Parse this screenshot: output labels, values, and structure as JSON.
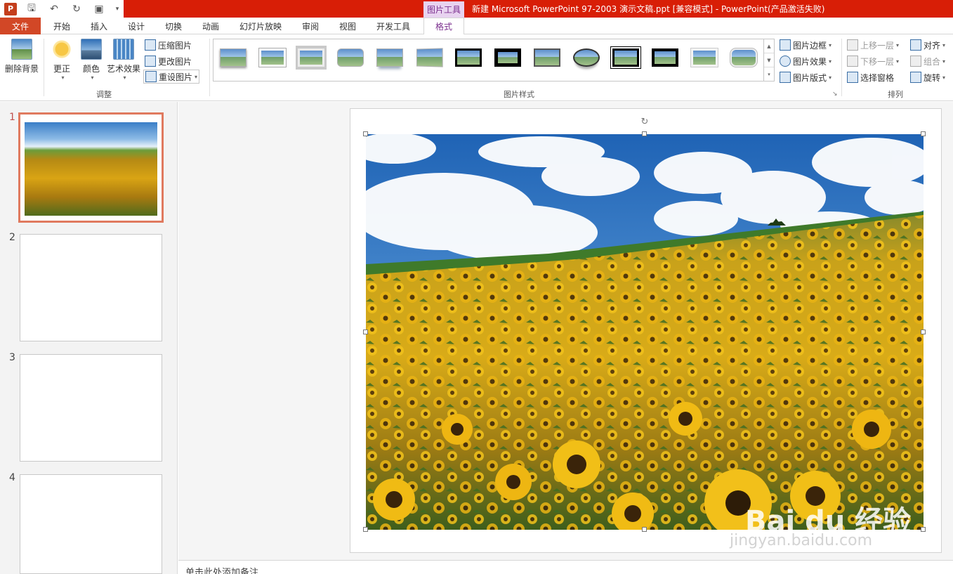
{
  "titlebar": {
    "context_tab": "图片工具",
    "title": "新建 Microsoft PowerPoint 97-2003 演示文稿.ppt [兼容模式] -  PowerPoint(产品激活失败)",
    "logo_text": "P",
    "colors": {
      "bar": "#d81e06",
      "file_tab": "#d24726",
      "accent": "#7b2f8e"
    }
  },
  "tabs": [
    "文件",
    "开始",
    "插入",
    "设计",
    "切换",
    "动画",
    "幻灯片放映",
    "审阅",
    "视图",
    "开发工具",
    "格式"
  ],
  "ribbon": {
    "adjust": {
      "remove_bg": "删除背景",
      "correct": "更正",
      "color": "颜色",
      "artistic": "艺术效果",
      "compress": "压缩图片",
      "change": "更改图片",
      "reset": "重设图片",
      "group_label": "调整"
    },
    "styles": {
      "group_label": "图片样式",
      "border": "图片边框",
      "effects": "图片效果",
      "layout": "图片版式",
      "thumbnail_count": 14
    },
    "arrange": {
      "bring_forward": "上移一层",
      "send_backward": "下移一层",
      "selection_pane": "选择窗格",
      "align": "对齐",
      "group": "组合",
      "rotate": "旋转",
      "group_label": "排列"
    }
  },
  "slides": [
    {
      "number": "1",
      "has_image": true
    },
    {
      "number": "2",
      "has_image": false
    },
    {
      "number": "3",
      "has_image": false
    },
    {
      "number": "4",
      "has_image": false
    }
  ],
  "notes_placeholder": "单击此处添加备注",
  "watermark": {
    "brand": "Bai du 经验",
    "url": "jingyan.baidu.com"
  }
}
